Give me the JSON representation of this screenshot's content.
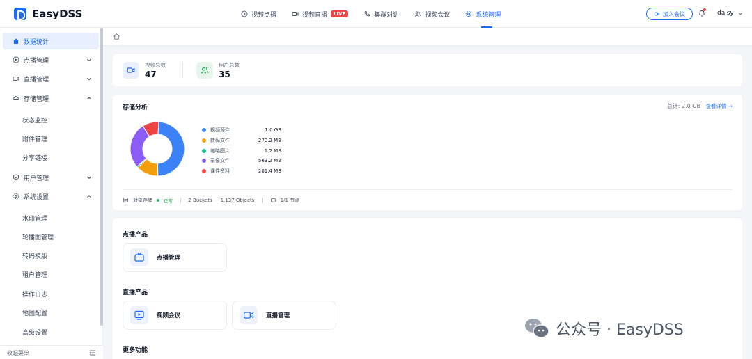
{
  "app": {
    "name": "EasyDSS"
  },
  "nav": [
    {
      "label": "视频点播",
      "icon": "play-circle-icon"
    },
    {
      "label": "视频直播",
      "icon": "video-camera-icon",
      "badge": "LIVE"
    },
    {
      "label": "集群对讲",
      "icon": "phone-icon"
    },
    {
      "label": "视频会议",
      "icon": "users-icon"
    },
    {
      "label": "系统管理",
      "icon": "gear-icon",
      "active": true
    }
  ],
  "header": {
    "join_meeting": "加入会议",
    "username": "daisy"
  },
  "sidebar": {
    "items": [
      {
        "label": "数据统计",
        "icon": "home-icon",
        "active": true
      },
      {
        "label": "点播管理",
        "icon": "play-circle-icon"
      },
      {
        "label": "直播管理",
        "icon": "video-camera-icon"
      },
      {
        "label": "存储管理",
        "icon": "cloud-icon",
        "expanded": true
      },
      {
        "label": "状态监控"
      },
      {
        "label": "附件管理"
      },
      {
        "label": "分享链接"
      },
      {
        "label": "用户管理",
        "icon": "shield-icon"
      },
      {
        "label": "系统设置",
        "icon": "gear-icon",
        "expanded": true
      },
      {
        "label": "水印管理"
      },
      {
        "label": "轮播图管理"
      },
      {
        "label": "转码模版"
      },
      {
        "label": "租户管理"
      },
      {
        "label": "操作日志"
      },
      {
        "label": "地图配置"
      },
      {
        "label": "高级设置"
      }
    ],
    "collapse_label": "收起菜单"
  },
  "stats": [
    {
      "label": "视频总数",
      "value": "47",
      "icon": "video-camera-icon",
      "color": "#2563eb"
    },
    {
      "label": "用户总数",
      "value": "35",
      "icon": "users-icon",
      "color": "#16a34a"
    }
  ],
  "storage": {
    "title": "存储分析",
    "total": "总计: 2.0 GB",
    "detail_link": "查看详情 →",
    "footer": {
      "type": "对象存储",
      "status": "正常",
      "buckets": "2 Buckets",
      "objects": "1,137 Objects",
      "nodes": "1/1 节点"
    }
  },
  "chart_data": {
    "type": "pie",
    "donut": true,
    "categories": [
      "视频源件",
      "转码文件",
      "缩略图片",
      "录像文件",
      "课件资料"
    ],
    "display_values": [
      "1.0 GB",
      "270.2 MB",
      "1.2 MB",
      "563.2 MB",
      "201.4 MB"
    ],
    "values_mb": [
      1024,
      270.2,
      1.2,
      563.2,
      201.4
    ],
    "colors": [
      "#3b82f6",
      "#f59e0b",
      "#10b981",
      "#8b5cf6",
      "#ef4444"
    ]
  },
  "sections": [
    {
      "title": "点播产品",
      "tiles": [
        {
          "label": "点播管理",
          "icon": "tv-icon"
        }
      ]
    },
    {
      "title": "直播产品",
      "tiles": [
        {
          "label": "视频会议",
          "icon": "monitor-play-icon"
        },
        {
          "label": "直播管理",
          "icon": "video-camera-icon"
        }
      ]
    },
    {
      "title": "更多功能",
      "tiles": []
    }
  ],
  "watermark": {
    "text": "公众号 · EasyDSS"
  }
}
